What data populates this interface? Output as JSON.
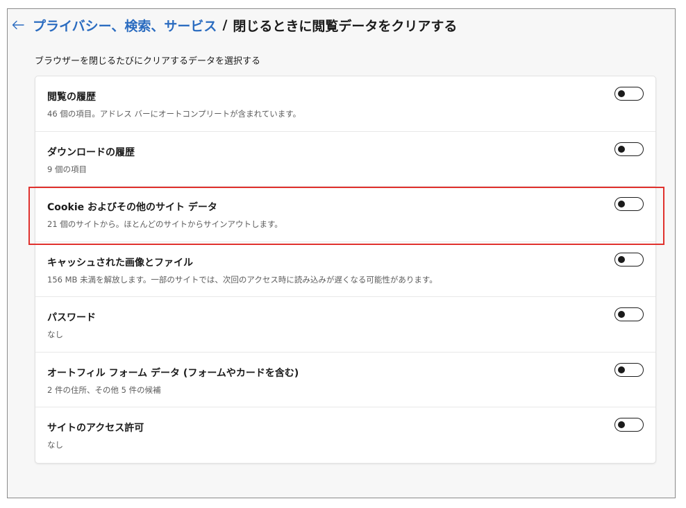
{
  "breadcrumb": {
    "parent": "プライバシー、検索、サービス",
    "separator": "/",
    "current": "閉じるときに閲覧データをクリアする"
  },
  "description": "ブラウザーを閉じるたびにクリアするデータを選択する",
  "items": [
    {
      "title": "閲覧の履歴",
      "subtitle": "46 個の項目。アドレス バーにオートコンプリートが含まれています。",
      "enabled": false
    },
    {
      "title": "ダウンロードの履歴",
      "subtitle": "9 個の項目",
      "enabled": false
    },
    {
      "title": "Cookie およびその他のサイト データ",
      "subtitle": "21 個のサイトから。ほとんどのサイトからサインアウトします。",
      "enabled": false
    },
    {
      "title": "キャッシュされた画像とファイル",
      "subtitle": "156 MB 未満を解放します。一部のサイトでは、次回のアクセス時に読み込みが遅くなる可能性があります。",
      "enabled": false
    },
    {
      "title": "パスワード",
      "subtitle": "なし",
      "enabled": false
    },
    {
      "title": "オートフィル フォーム データ (フォームやカードを含む)",
      "subtitle": "2 件の住所、その他 5 件の候補",
      "enabled": false
    },
    {
      "title": "サイトのアクセス許可",
      "subtitle": "なし",
      "enabled": false
    }
  ],
  "icons": {
    "back": "arrow-left-icon"
  },
  "colors": {
    "link": "#2b6cc0",
    "highlight": "#e0312d",
    "toggle_off": "#1b1b1b"
  }
}
